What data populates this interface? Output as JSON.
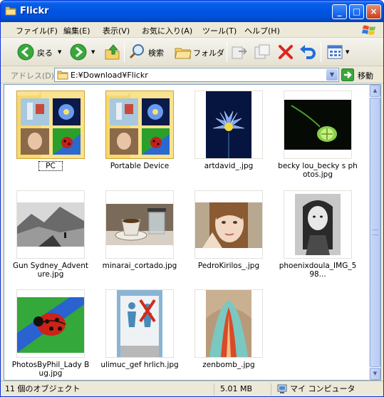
{
  "window": {
    "title": "Flickr"
  },
  "title_buttons": {
    "minimize": "_",
    "maximize": "□",
    "close": "×"
  },
  "menu": [
    {
      "label": "ファイル(F)"
    },
    {
      "label": "編集(E)"
    },
    {
      "label": "表示(V)"
    },
    {
      "label": "お気に入り(A)"
    },
    {
      "label": "ツール(T)"
    },
    {
      "label": "ヘルプ(H)"
    }
  ],
  "toolbar": {
    "back_label": "戻る",
    "search_label": "検索",
    "folders_label": "フォルダ"
  },
  "address": {
    "label": "アドレス(D)",
    "value": "E:¥Download¥Flickr",
    "go_label": "移動"
  },
  "items": [
    {
      "name": "PC",
      "type": "folder",
      "selected": true
    },
    {
      "name": "Portable Device",
      "type": "folder",
      "selected": false
    },
    {
      "name": "artdavid_.jpg",
      "type": "image",
      "thumb": "blue-flower"
    },
    {
      "name": "becky lou_becky s photos.jpg",
      "type": "image",
      "thumb": "green-bud"
    },
    {
      "name": "Gun Sydney_Adventure.jpg",
      "type": "image",
      "thumb": "bw-landscape"
    },
    {
      "name": "minarai_cortado.jpg",
      "type": "image",
      "thumb": "coffee-glass"
    },
    {
      "name": "PedroKirilos_.jpg",
      "type": "image",
      "thumb": "woman-portrait"
    },
    {
      "name": "phoenixdoula_IMG_598...",
      "type": "image",
      "thumb": "bw-child"
    },
    {
      "name": "PhotosByPhil_Lady Bug.jpg",
      "type": "image",
      "thumb": "ladybug"
    },
    {
      "name": "ulimuc_gef hrlich.jpg",
      "type": "image",
      "thumb": "sign"
    },
    {
      "name": "zenbomb_.jpg",
      "type": "image",
      "thumb": "abstract"
    }
  ],
  "status": {
    "objects": "11 個のオブジェクト",
    "size": "5.01 MB",
    "location": "マイ コンピュータ"
  }
}
